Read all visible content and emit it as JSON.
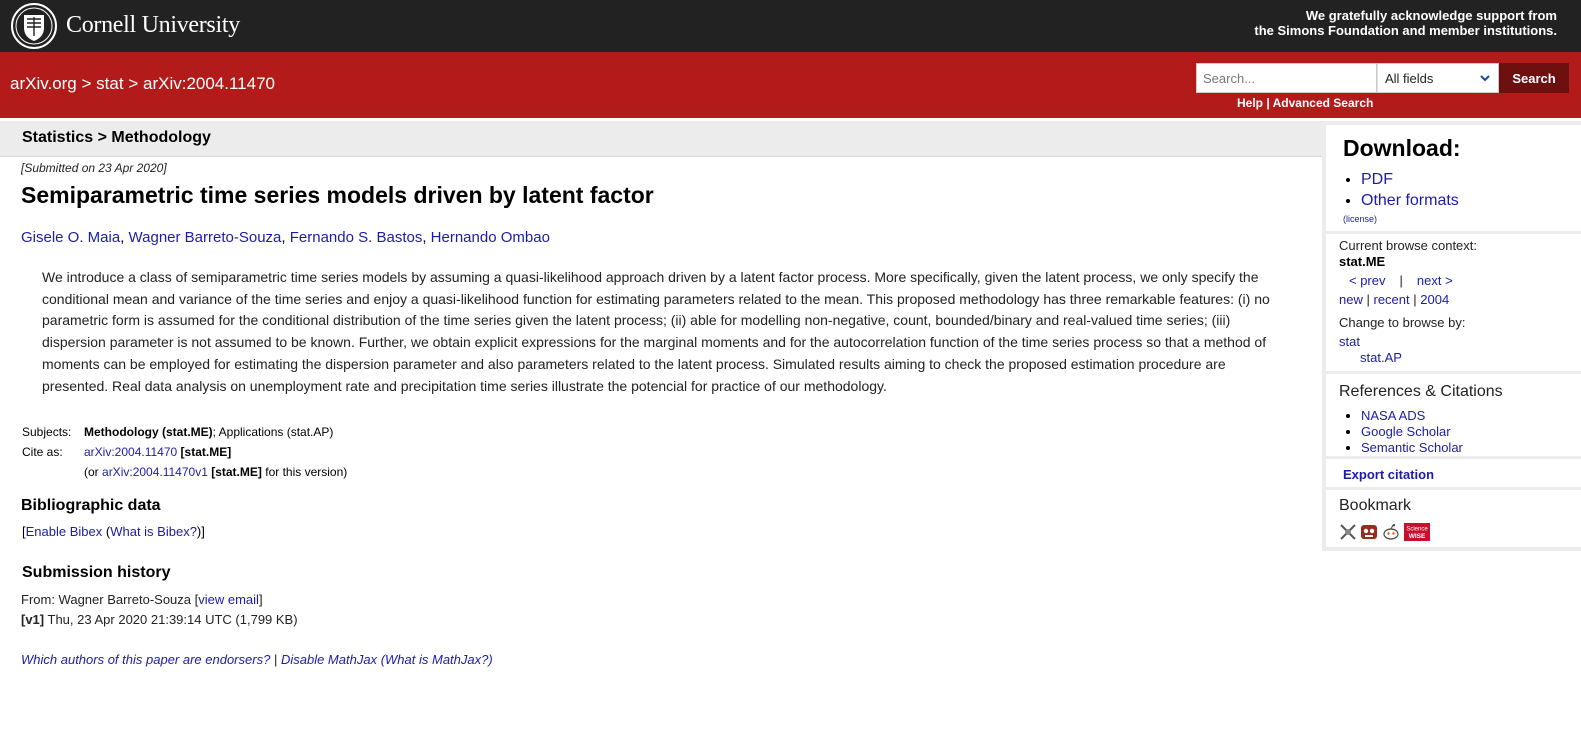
{
  "header": {
    "brand": "Cornell University",
    "support_line1": "We gratefully acknowledge support from",
    "support_line2": "the Simons Foundation and member institutions."
  },
  "nav": {
    "crumb1": "arXiv.org",
    "sep": ">",
    "crumb2": "stat",
    "crumb3": "arXiv:2004.11470"
  },
  "search": {
    "placeholder": "Search...",
    "field": "All fields",
    "button": "Search",
    "help": "Help",
    "divider": "|",
    "advanced": "Advanced Search"
  },
  "subheader": {
    "title": "Statistics > Methodology"
  },
  "paper": {
    "submitted": "[Submitted on 23 Apr 2020]",
    "title": "Semiparametric time series models driven by latent factor",
    "authors": [
      "Gisele O. Maia",
      "Wagner Barreto-Souza",
      "Fernando S. Bastos",
      "Hernando Ombao"
    ],
    "abstract": "We introduce a class of semiparametric time series models by assuming a quasi-likelihood approach driven by a latent factor process. More specifically, given the latent process, we only specify the conditional mean and variance of the time series and enjoy a quasi-likelihood function for estimating parameters related to the mean. This proposed methodology has three remarkable features: (i) no parametric form is assumed for the conditional distribution of the time series given the latent process; (ii) able for modelling non-negative, count, bounded/binary and real-valued time series; (iii) dispersion parameter is not assumed to be known. Further, we obtain explicit expressions for the marginal moments and for the autocorrelation function of the time series process so that a method of moments can be employed for estimating the dispersion parameter and also parameters related to the latent process. Simulated results aiming to check the proposed estimation procedure are presented. Real data analysis on unemployment rate and precipitation time series illustrate the potencial for practice of our methodology."
  },
  "meta": {
    "subjects_label": "Subjects:",
    "subject_primary": "Methodology (stat.ME)",
    "subject_rest": "; Applications (stat.AP)",
    "cite_label": "Cite as:",
    "cite_id": "arXiv:2004.11470",
    "cite_cat": "[stat.ME]",
    "version_open": "(or",
    "version_id": "arXiv:2004.11470v1",
    "version_cat": "[stat.ME]",
    "version_close": "for this version)"
  },
  "bib": {
    "heading": "Bibliographic data",
    "open_bracket": "[",
    "enable": "Enable Bibex",
    "what_open": "(",
    "what": "What is Bibex?",
    "close": ")]"
  },
  "history": {
    "heading": "Submission history",
    "from_text": "From: Wagner Barreto-Souza [",
    "view_email": "view email",
    "from_close": "]",
    "version_tag": "[v1]",
    "version_text": "Thu, 23 Apr 2020 21:39:14 UTC (1,799 KB)"
  },
  "footer": {
    "endorsers": "Which authors of this paper are endorsers?",
    "sep": "|",
    "disable_mathjax": "Disable MathJax",
    "what_mathjax_open": "(",
    "what_mathjax": "What is MathJax?",
    "what_mathjax_close": ")"
  },
  "sidebar": {
    "download_heading": "Download:",
    "downloads": [
      "PDF",
      "Other formats"
    ],
    "license": "(license)",
    "context_label": "Current browse context:",
    "context_value": "stat.ME",
    "prev": "< prev",
    "nav_sep": "|",
    "next": "next >",
    "new": "new",
    "recent": "recent",
    "year": "2004",
    "browse_label": "Change to browse by:",
    "browse_stat": "stat",
    "browse_statap": "stat.AP",
    "refs_heading": "References & Citations",
    "refs": [
      "NASA ADS",
      "Google Scholar",
      "Semantic Scholar"
    ],
    "export": "Export citation",
    "bookmark_heading": "Bookmark",
    "bookmark_icons": [
      "bibsonomy-icon",
      "mendeley-icon",
      "reddit-icon",
      "sciencewise-icon"
    ],
    "sciencewise_line1": "Science",
    "sciencewise_line2": "WISE"
  },
  "colors": {
    "top_bar": "#222222",
    "red_bar": "#b31b1b",
    "search_button": "#6e1010",
    "link": "#1c1ca8",
    "subheader_bg": "#ececec"
  }
}
